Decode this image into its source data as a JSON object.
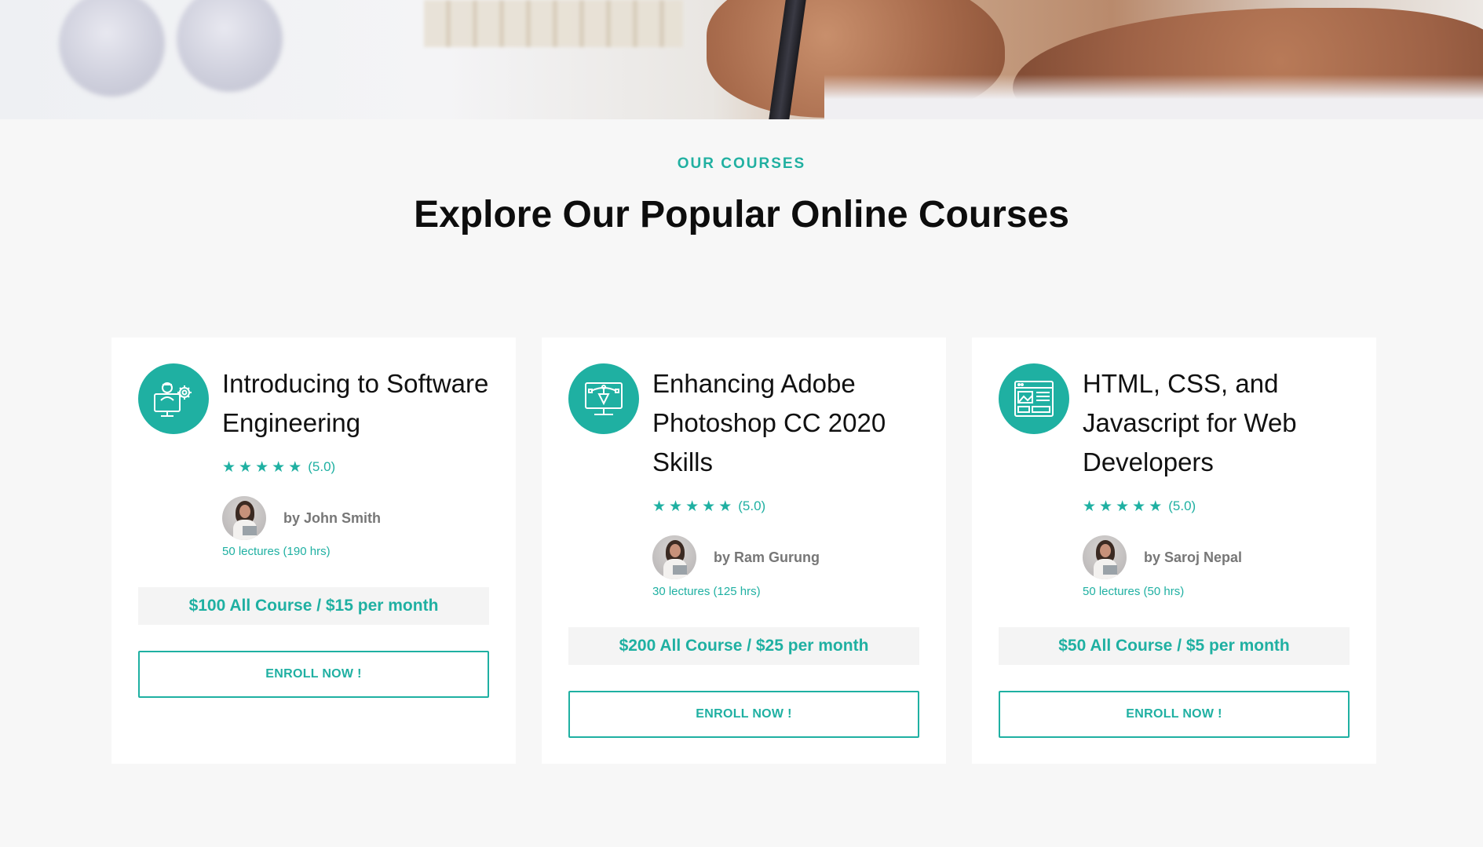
{
  "section": {
    "eyebrow": "OUR COURSES",
    "heading": "Explore Our Popular Online Courses"
  },
  "theme": {
    "accent": "#1fb0a2",
    "background": "#f7f7f7",
    "card": "#ffffff"
  },
  "courses": [
    {
      "icon": "engineer-gear-icon",
      "title": "Introducing to Software Engineering",
      "rating": 5,
      "rating_label": "(5.0)",
      "author": "by John Smith",
      "lectures": "50 lectures (190 hrs)",
      "price": "$100 All Course / $15 per month",
      "cta": "ENROLL NOW !"
    },
    {
      "icon": "design-monitor-icon",
      "title": "Enhancing Adobe Photoshop CC 2020 Skills",
      "rating": 5,
      "rating_label": "(5.0)",
      "author": "by Ram Gurung",
      "lectures": "30 lectures (125 hrs)",
      "price": "$200 All Course / $25 per month",
      "cta": "ENROLL NOW !"
    },
    {
      "icon": "web-layout-icon",
      "title": "HTML, CSS, and Javascript for Web Developers",
      "rating": 5,
      "rating_label": "(5.0)",
      "author": "by Saroj Nepal",
      "lectures": "50 lectures (50 hrs)",
      "price": "$50 All Course / $5 per month",
      "cta": "ENROLL NOW !"
    }
  ]
}
